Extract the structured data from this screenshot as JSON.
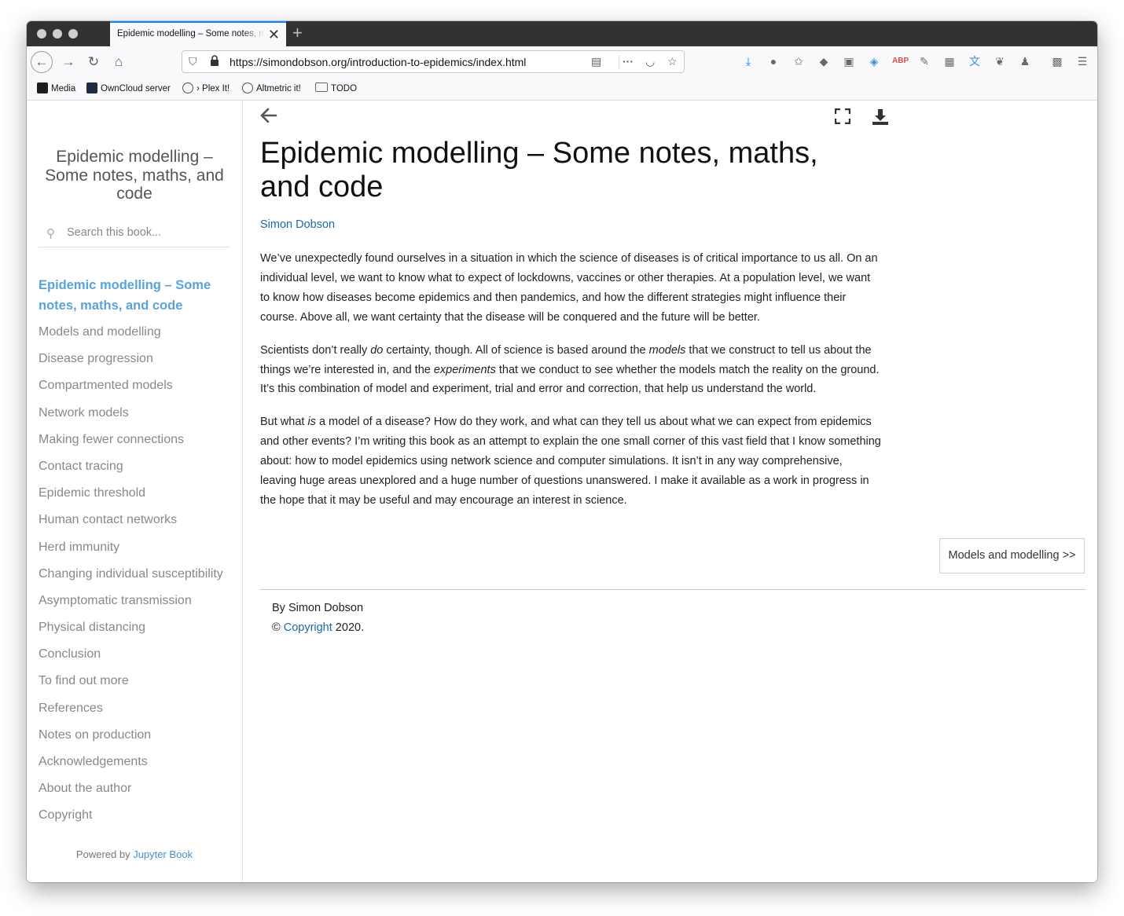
{
  "browser": {
    "tab_title": "Epidemic modelling – Some notes, maths, and code",
    "tab_close": "✕",
    "new_tab": "+",
    "url": "https://simondobson.org/introduction-to-epidemics/index.html",
    "accent": "#0a84ff",
    "bookmarks": [
      {
        "label": "Media",
        "icon": "media-icon"
      },
      {
        "label": "OwnCloud server",
        "icon": "owncloud-icon"
      },
      {
        "label": "› Plex It!",
        "icon": "globe-icon"
      },
      {
        "label": "Altmetric it!",
        "icon": "globe-icon"
      },
      {
        "label": "TODO",
        "icon": "folder-icon"
      }
    ]
  },
  "sidebar": {
    "title": "Epidemic modelling – Some notes, maths, and code",
    "search_placeholder": "Search this book...",
    "toc": [
      "Epidemic modelling – Some notes, maths, and code",
      "Models and modelling",
      "Disease progression",
      "Compartmented models",
      "Network models",
      "Making fewer connections",
      "Contact tracing",
      "Epidemic threshold",
      "Human contact networks",
      "Herd immunity",
      "Changing individual susceptibility",
      "Asymptomatic transmission",
      "Physical distancing",
      "Conclusion",
      "To find out more",
      "References",
      "Notes on production",
      "Acknowledgements",
      "About the author",
      "Copyright"
    ],
    "powered_prefix": "Powered by ",
    "powered_link": "Jupyter Book",
    "active_color": "#5aa3d8"
  },
  "content": {
    "title": "Epidemic modelling – Some notes, maths, and code",
    "author": "Simon Dobson",
    "p1": "We’ve unexpectedly found ourselves in a situation in which the science of diseases is of critical importance to us all. On an individual level, we want to know what to expect of lockdowns, vaccines or other therapies. At a population level, we want to know how diseases become epidemics and then pandemics, and how the different strategies might influence their course. Above all, we want certainty that the disease will be conquered and the future will be better.",
    "p2": {
      "a": "Scientists don’t really ",
      "b": "do",
      "c": " certainty, though. All of science is based around the ",
      "d": "models",
      "e": " that we construct to tell us about the things we’re interested in, and the ",
      "f": "experiments",
      "g": " that we conduct to see whether the models match the reality on the ground. It’s this combination of model and experiment, trial and error and correction, that help us understand the world."
    },
    "p3": {
      "a": "But what ",
      "b": "is",
      "c": " a model of a disease? How do they work, and what can they tell us about what we can expect from epidemics and other events? I’m writing this book as an attempt to explain the one small corner of this vast field that I know something about: how to model epidemics using network science and computer simulations. It isn’t in any way comprehensive, leaving huge areas unexplored and a huge number of questions unanswered. I make it available as a work in progress in the hope that it may be useful and may encourage an interest in science."
    },
    "next_button": "Models and modelling >>",
    "footer_by": "By Simon Dobson",
    "footer_copy_prefix": "© ",
    "footer_copy_link": "Copyright",
    "footer_copy_suffix": " 2020.",
    "link_color": "#1c6aa0"
  }
}
